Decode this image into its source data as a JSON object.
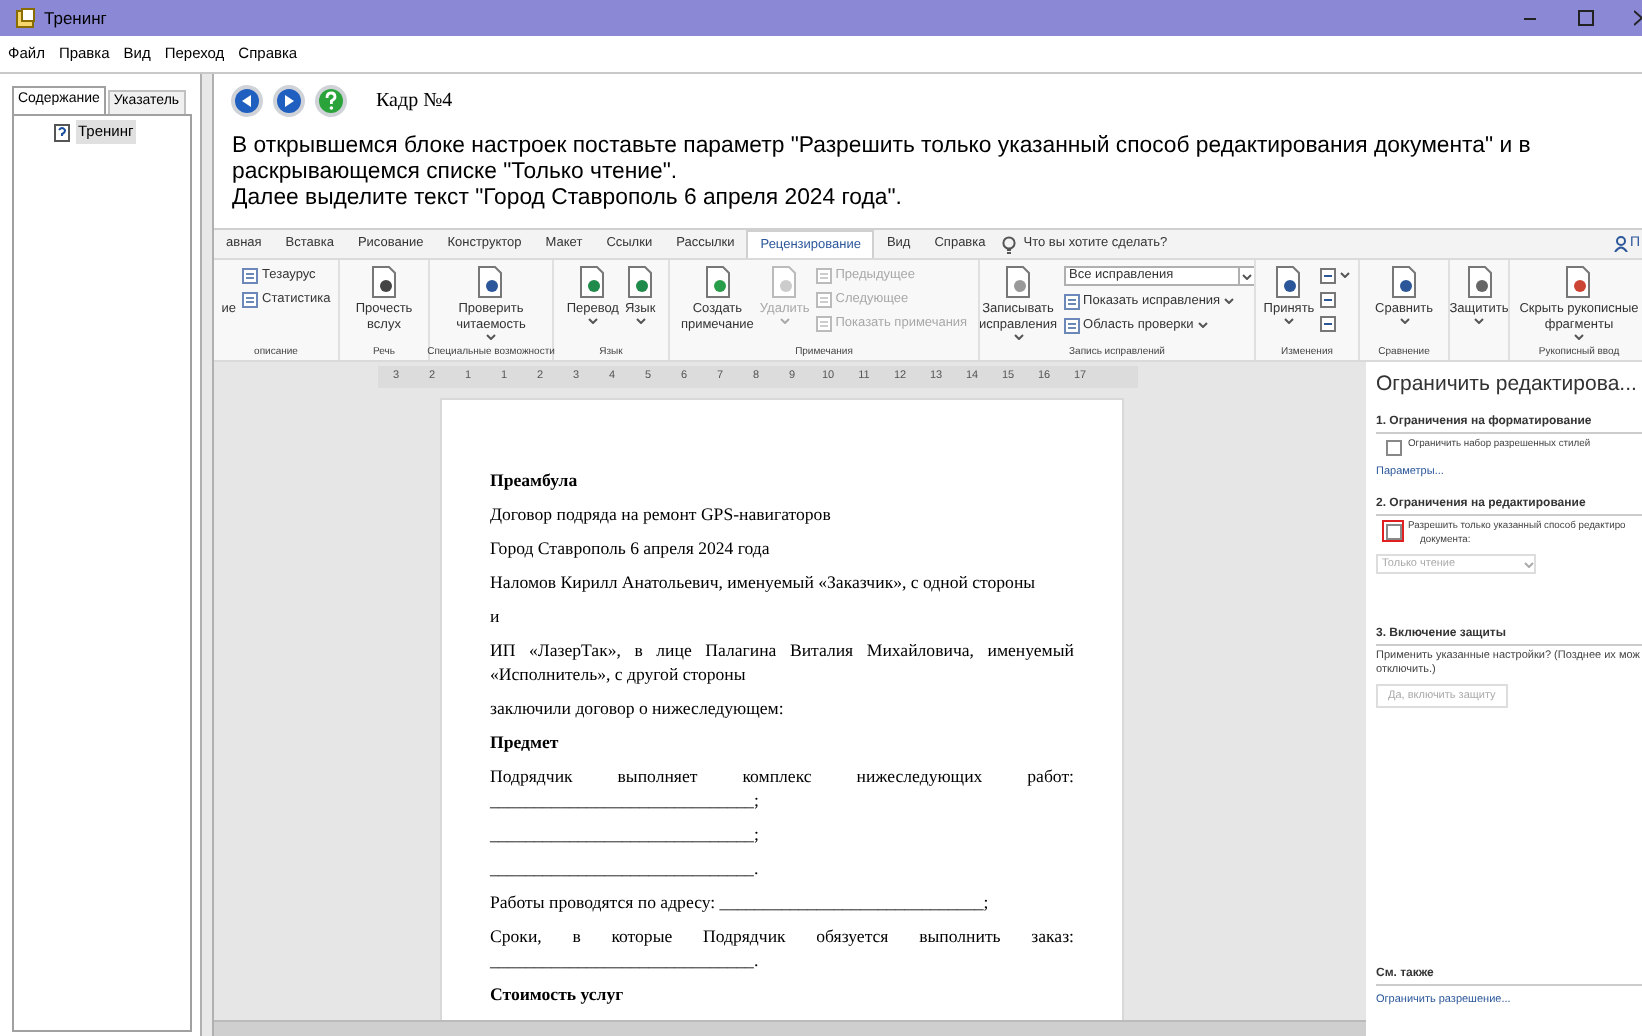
{
  "window": {
    "title": "Тренинг"
  },
  "menu": [
    "Файл",
    "Правка",
    "Вид",
    "Переход",
    "Справка"
  ],
  "sidebar": {
    "tabs": [
      {
        "label": "Содержание",
        "selected": true
      },
      {
        "label": "Указатель",
        "selected": false
      }
    ],
    "tree": [
      {
        "label": "Тренинг",
        "selected": true
      }
    ]
  },
  "frame": {
    "title": "Кадр №4",
    "instruction": [
      "В открывшемся блоке настроек поставьте параметр \"Разрешить только указанный способ редактирования документа\" и в раскрывающемся списке \"Только чтение\".",
      "Далее выделите текст \"Город Ставрополь 6 апреля 2024 года\"."
    ]
  },
  "word": {
    "tabs": [
      {
        "label": "авная",
        "selected": false
      },
      {
        "label": "Вставка",
        "selected": false
      },
      {
        "label": "Рисование",
        "selected": false
      },
      {
        "label": "Конструктор",
        "selected": false
      },
      {
        "label": "Макет",
        "selected": false
      },
      {
        "label": "Ссылки",
        "selected": false
      },
      {
        "label": "Рассылки",
        "selected": false
      },
      {
        "label": "Рецензирование",
        "selected": true
      },
      {
        "label": "Вид",
        "selected": false
      },
      {
        "label": "Справка",
        "selected": false
      }
    ],
    "tell_me": "Что вы хотите сделать?",
    "share": "П",
    "groups": [
      {
        "label": "описание",
        "columns": [
          [
            {
              "kind": "text",
              "label": "ие"
            }
          ],
          [
            {
              "kind": "small",
              "label": "Тезаурус",
              "disabled": false,
              "caret": false
            },
            {
              "kind": "small",
              "label": "Статистика",
              "disabled": false,
              "caret": false
            }
          ]
        ]
      },
      {
        "label": "Речь",
        "columns": [
          [
            {
              "kind": "large",
              "lines": [
                "Прочесть",
                "вслух"
              ],
              "disabled": false,
              "caret": false
            }
          ]
        ]
      },
      {
        "label": "Специальные возможности",
        "columns": [
          [
            {
              "kind": "large",
              "lines": [
                "Проверить",
                "читаемость"
              ],
              "disabled": false,
              "caret": true
            }
          ]
        ]
      },
      {
        "label": "Язык",
        "columns": [
          [
            {
              "kind": "large",
              "lines": [
                "Перевод"
              ],
              "disabled": false,
              "caret": true
            }
          ],
          [
            {
              "kind": "large",
              "lines": [
                "Язык"
              ],
              "disabled": false,
              "caret": true
            }
          ]
        ]
      },
      {
        "label": "Примечания",
        "columns": [
          [
            {
              "kind": "large",
              "lines": [
                "Создать",
                "примечание"
              ],
              "disabled": false,
              "caret": false
            }
          ],
          [
            {
              "kind": "large",
              "lines": [
                "Удалить"
              ],
              "disabled": true,
              "caret": true
            }
          ],
          [
            {
              "kind": "small",
              "label": "Предыдущее",
              "disabled": true,
              "caret": false
            },
            {
              "kind": "small",
              "label": "Следующее",
              "disabled": true,
              "caret": false
            },
            {
              "kind": "small",
              "label": "Показать примечания",
              "disabled": true,
              "caret": false
            }
          ]
        ]
      },
      {
        "label": "Запись исправлений",
        "columns": [
          [
            {
              "kind": "large",
              "lines": [
                "Записывать",
                "исправления"
              ],
              "disabled": false,
              "caret": true
            }
          ],
          [
            {
              "kind": "dropdown",
              "label": "Все исправления",
              "disabled": false,
              "caret": true
            },
            {
              "kind": "small",
              "label": "Показать исправления",
              "disabled": false,
              "caret": true
            },
            {
              "kind": "small",
              "label": "Область проверки",
              "disabled": false,
              "caret": true
            }
          ]
        ]
      },
      {
        "label": "Изменения",
        "columns": [
          [
            {
              "kind": "large",
              "lines": [
                "Принять"
              ],
              "disabled": false,
              "caret": true
            }
          ],
          [
            {
              "kind": "icon",
              "disabled": false,
              "caret": true
            },
            {
              "kind": "icon",
              "disabled": false,
              "caret": false
            },
            {
              "kind": "icon",
              "disabled": false,
              "caret": false
            }
          ]
        ]
      },
      {
        "label": "Сравнение",
        "columns": [
          [
            {
              "kind": "large",
              "lines": [
                "Сравнить"
              ],
              "disabled": false,
              "caret": true
            }
          ]
        ]
      },
      {
        "columns": [
          [
            {
              "kind": "large",
              "lines": [
                "Защитить"
              ],
              "disabled": false,
              "caret": true
            }
          ]
        ]
      },
      {
        "label": "Рукописный ввод",
        "columns": [
          [
            {
              "kind": "large",
              "lines": [
                "Скрыть рукописные",
                "фрагменты"
              ],
              "disabled": false,
              "caret": true
            }
          ]
        ]
      }
    ],
    "ruler": [
      "3",
      "2",
      "1",
      "1",
      "2",
      "3",
      "4",
      "5",
      "6",
      "7",
      "8",
      "9",
      "10",
      "11",
      "12",
      "13",
      "14",
      "15",
      "16",
      "17"
    ],
    "document": [
      {
        "kind": "heading",
        "text": "Преамбула"
      },
      {
        "kind": "para",
        "text": "Договор подряда на ремонт GPS-навигаторов"
      },
      {
        "kind": "para",
        "text": "Город Ставрополь 6 апреля 2024 года"
      },
      {
        "kind": "para",
        "text": "Наломов Кирилл Анатольевич, именуемый «Заказчик», с одной стороны"
      },
      {
        "kind": "para",
        "text": "и"
      },
      {
        "kind": "justified",
        "text": "ИП «ЛазерТак», в лице Палагина Виталия Михайловича, именуемый «Исполнитель», с другой стороны"
      },
      {
        "kind": "para",
        "text": "заключили договор о нижеследующем:"
      },
      {
        "kind": "heading",
        "text": "Предмет"
      },
      {
        "kind": "justified",
        "text": "Подрядчик выполняет комплекс нижеследующих работ: ______________________________;"
      },
      {
        "kind": "para",
        "text": "______________________________;"
      },
      {
        "kind": "para",
        "text": "______________________________."
      },
      {
        "kind": "para",
        "text": "Работы проводятся по адресу: ______________________________;"
      },
      {
        "kind": "justified",
        "text": "Сроки, в которые Подрядчик обязуется выполнить заказ: ______________________________."
      },
      {
        "kind": "heading",
        "text": "Стоимость услуг"
      }
    ],
    "pane": {
      "title": "Ограничить редактирова...",
      "sections": [
        {
          "heading": "1. Ограничения на форматирование",
          "checkbox": {
            "lines": [
              "Ограничить набор разрешенных стилей"
            ],
            "checked": false,
            "highlighted": false
          },
          "link": "Параметры..."
        },
        {
          "heading": "2. Ограничения на редактирование",
          "checkbox": {
            "lines": [
              "Разрешить только указанный способ редактиро",
              "документа:"
            ],
            "checked": false,
            "highlighted": true
          },
          "dropdown": {
            "value": "Только чтение",
            "disabled": true
          }
        },
        {
          "heading": "3. Включение защиты",
          "note": [
            "Применить указанные настройки? (Позднее их мож",
            "отключить.)"
          ],
          "button": {
            "label": "Да, включить защиту",
            "disabled": true
          }
        }
      ],
      "see_also": "См. также",
      "see_also_link": "Ограничить разрешение..."
    }
  }
}
